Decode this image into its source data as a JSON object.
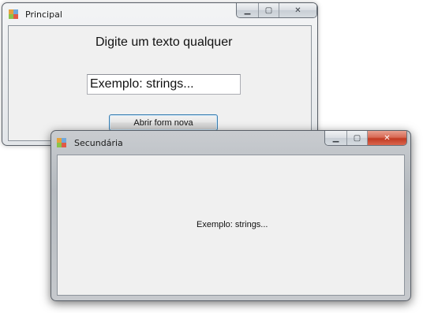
{
  "windows": {
    "principal": {
      "title": "Principal",
      "heading": "Digite um texto qualquer",
      "input_value": "Exemplo: strings...",
      "button_label": "Abrir form nova"
    },
    "secundaria": {
      "title": "Secundária",
      "label_text": "Exemplo: strings..."
    }
  },
  "caption_glyphs": {
    "minimize": "▁",
    "maximize": "▢",
    "close": "✕"
  },
  "icons": {
    "app_icon": "windows-form-icon",
    "minimize": "minimize-icon",
    "maximize": "maximize-icon",
    "close": "close-icon"
  },
  "colors": {
    "close_active": "#c23a22",
    "button_border": "#3c7fb1",
    "form_background": "#f0f0f0"
  }
}
